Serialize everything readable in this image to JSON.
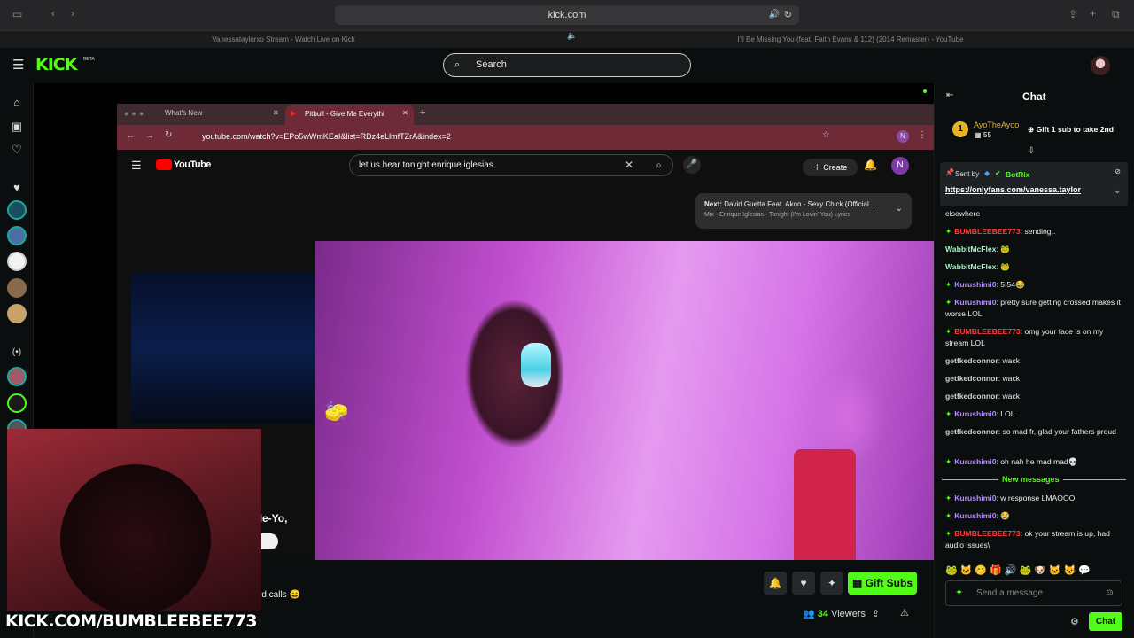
{
  "safari": {
    "url": "kick.com",
    "tab1_title": "Vanessataylorxo Stream - Watch Live on Kick",
    "tab2_title": "I'll Be Missing You (feat. Faith Evans & 112) (2014 Remaster) - YouTube"
  },
  "header": {
    "logo": "KICK",
    "beta": "BETA",
    "search_placeholder": "Search"
  },
  "stream_overlay": {
    "chrome_tab1": "What's New",
    "chrome_tab2": "Pitbull - Give Me Everythi",
    "chrome_url": "youtube.com/watch?v=EPo5wWmKEaI&list=RDz4eLlmfTZrA&index=2",
    "yt_logo": "YouTube",
    "yt_search": "let us hear tonight enrique iglesias",
    "yt_create": "Create",
    "yt_avatar": "N",
    "next_label": "Next:",
    "next_title": "David Guetta Feat. Akon - Sexy Chick (Official ...",
    "next_sub": "Mix - Enrique Iglesias - Tonight (I'm Lovin' You) Lyrics",
    "yt_title_fragment": "g ft. Ne-Yo,",
    "yt_calls_fragment": "rd calls 😄",
    "watermark": "KICK.COM/BUMBLEEBEE773"
  },
  "actions": {
    "gift_subs": "Gift Subs",
    "viewer_count": "34",
    "viewers_label": "Viewers"
  },
  "chat": {
    "title": "Chat",
    "top_gifter": "AyoTheAyoo",
    "top_gifter_count": "55",
    "gift_prompt": "Gift 1 sub to take 2nd",
    "pinned_sent_by": "Sent by",
    "pinned_bot": "BotRix",
    "pinned_link": "https://onlyfans.com/vanessa.taylor",
    "new_messages_label": "New messages",
    "input_placeholder": "Send a message",
    "chat_button": "Chat",
    "messages": [
      {
        "user": "",
        "text": "elsewhere",
        "color": "plain"
      },
      {
        "user": "BUMBLEEBEE773",
        "text": ": sending..",
        "color": "red",
        "badge": true
      },
      {
        "user": "WabbitMcFlex",
        "text": ": 🐸",
        "color": "green"
      },
      {
        "user": "WabbitMcFlex",
        "text": ": 🐸",
        "color": "green"
      },
      {
        "user": "Kurushimi0",
        "text": ": 5:54😂",
        "color": "purple",
        "badge": true
      },
      {
        "user": "Kurushimi0",
        "text": ": pretty sure getting crossed makes it worse LOL",
        "color": "purple",
        "badge": true
      },
      {
        "user": "BUMBLEEBEE773",
        "text": ": omg your face is on my stream LOL",
        "color": "red",
        "badge": true
      },
      {
        "user": "getfkedconnor",
        "text": ": wack",
        "color": "gray"
      },
      {
        "user": "getfkedconnor",
        "text": ": wack",
        "color": "gray"
      },
      {
        "user": "getfkedconnor",
        "text": ": wack",
        "color": "gray"
      },
      {
        "user": "Kurushimi0",
        "text": ": LOL",
        "color": "purple",
        "badge": true
      },
      {
        "user": "getfkedconnor",
        "text": ": so mad fr, glad your fathers proud",
        "color": "gray"
      },
      {
        "user": "Kurushimi0",
        "text": ": oh nah he mad mad💀",
        "color": "purple",
        "badge": true
      },
      {
        "user": "Kurushimi0",
        "text": ": w response LMAOOO",
        "color": "purple",
        "badge": true
      },
      {
        "user": "Kurushimi0",
        "text": ": 😂",
        "color": "purple",
        "badge": true
      },
      {
        "user": "BUMBLEEBEE773",
        "text": ": ok your stream is up, had audio issues\\",
        "color": "red",
        "badge": true
      }
    ]
  }
}
